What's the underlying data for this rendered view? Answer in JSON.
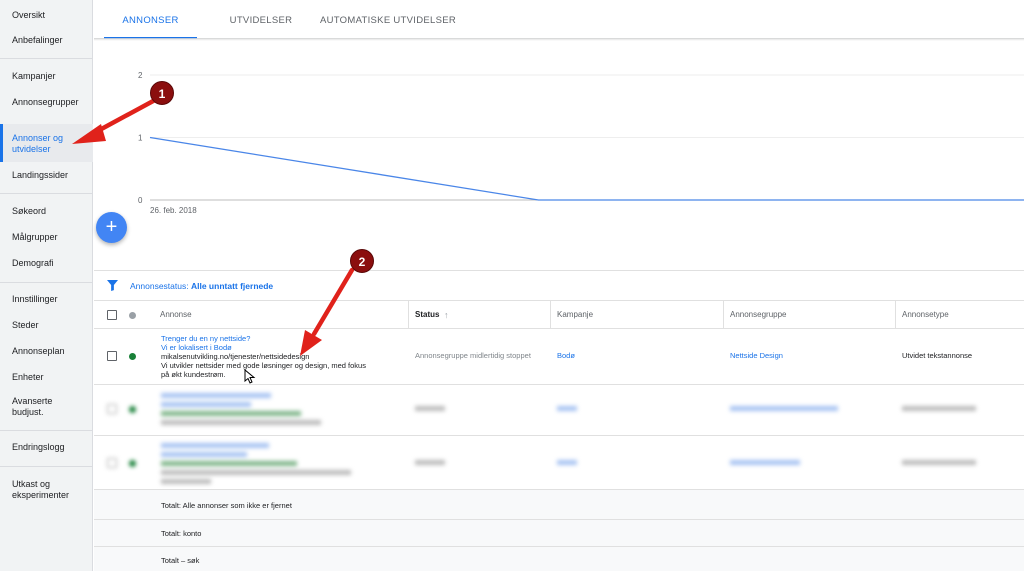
{
  "sidebar": {
    "items": [
      {
        "label": "Oversikt"
      },
      {
        "label": "Anbefalinger"
      },
      {
        "label": "Kampanjer"
      },
      {
        "label": "Annonsegrupper"
      },
      {
        "label": "Annonser og utvidelser"
      },
      {
        "label": "Landingssider"
      },
      {
        "label": "Søkeord"
      },
      {
        "label": "Målgrupper"
      },
      {
        "label": "Demografi"
      },
      {
        "label": "Innstillinger"
      },
      {
        "label": "Steder"
      },
      {
        "label": "Annonseplan"
      },
      {
        "label": "Enheter"
      },
      {
        "label": "Avanserte budjust."
      },
      {
        "label": "Endringslogg"
      },
      {
        "label": "Utkast og eksperimenter"
      }
    ]
  },
  "tabs": [
    {
      "label": "ANNONSER"
    },
    {
      "label": "UTVIDELSER"
    },
    {
      "label": "AUTOMATISKE UTVIDELSER"
    }
  ],
  "chart_data": {
    "type": "line",
    "x": [
      "26. feb. 2018",
      "",
      "",
      "",
      "",
      "",
      "",
      "",
      "",
      ""
    ],
    "series": [
      {
        "values": [
          1,
          0.75,
          0.5,
          0.25,
          0,
          0,
          0,
          0,
          0,
          0
        ]
      }
    ],
    "yticks": [
      "2",
      "1",
      "0"
    ],
    "ylim": [
      0,
      2
    ],
    "xtick_label": "26. feb. 2018",
    "grid": true
  },
  "fab": {
    "label": "+"
  },
  "filter": {
    "prefix": "Annonsestatus:",
    "value": "Alle unntatt fjernede"
  },
  "table": {
    "headers": {
      "annonse": "Annonse",
      "status": "Status",
      "sort_icon": "↑",
      "kampanje": "Kampanje",
      "annonsegruppe": "Annonsegruppe",
      "annonsetype": "Annonsetype"
    },
    "rows": [
      {
        "headline": "Trenger du en ny nettside?",
        "headline2": "Vi er lokalisert i Bodø",
        "url": "mikalsenutvikling.no/tjenester/nettsidedesign",
        "desc1": "Vi utvikler nettsider med gode løsninger og design, med fokus",
        "desc2": "på økt kundestrøm.",
        "status": "Annonsegruppe midlertidig stoppet",
        "kampanje": "Bodø",
        "annonsegruppe": "Nettside Design",
        "annonsetype": "Utvidet tekstannonse"
      }
    ],
    "totals": [
      {
        "label": "Totalt: Alle annonser som ikke er fjernet"
      },
      {
        "label": "Totalt: konto"
      },
      {
        "label": "Totalt – søk"
      }
    ]
  },
  "annotations": [
    {
      "label": "1"
    },
    {
      "label": "2"
    }
  ],
  "colors": {
    "accent": "#1a73e8",
    "line": "#4a86e8",
    "status_green": "#0f9d58",
    "badge": "#8b0e0e",
    "arrow": "#e0221b"
  }
}
